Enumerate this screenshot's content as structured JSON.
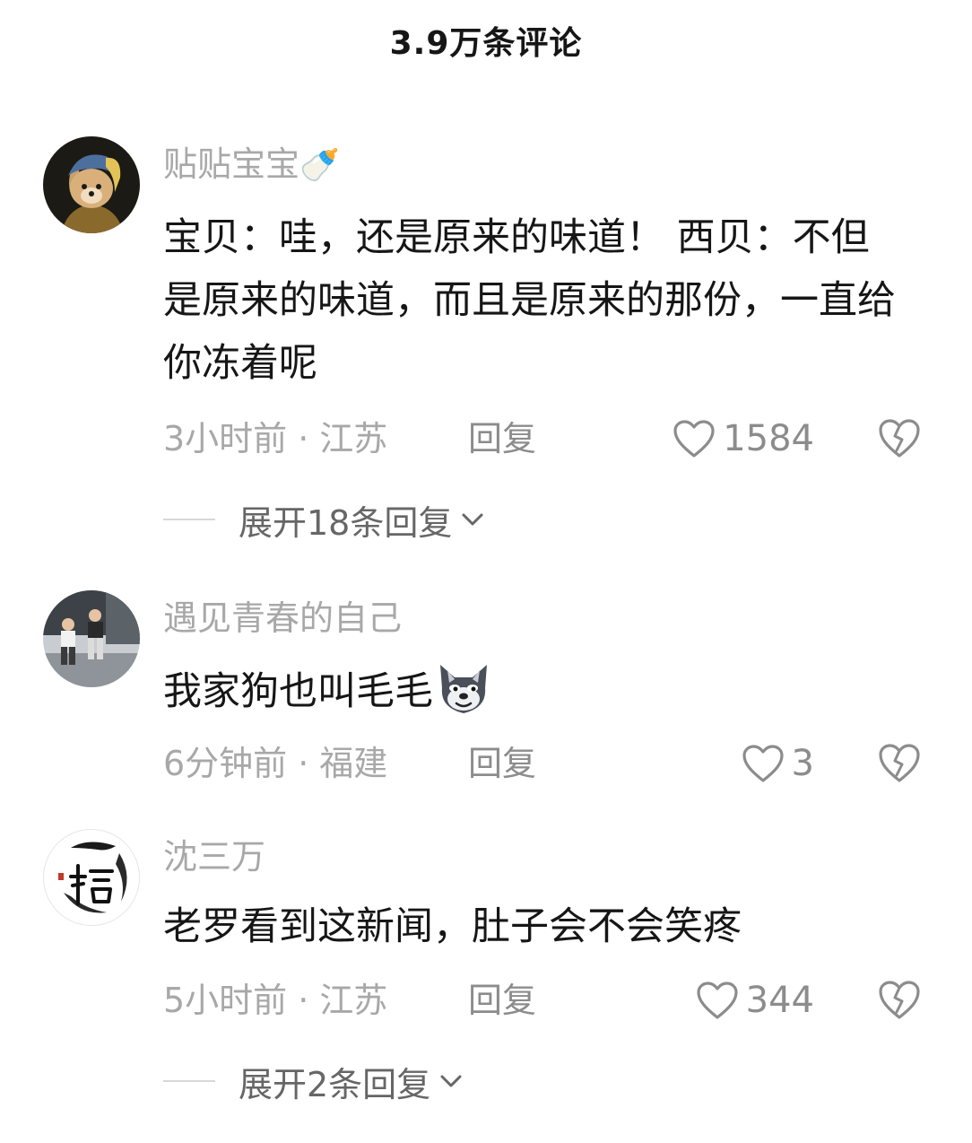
{
  "header": {
    "title": "3.9万条评论"
  },
  "comments": [
    {
      "username": "贴贴宝宝",
      "username_emoji": "🍼",
      "content": "宝贝：哇，还是原来的味道！ 西贝：不但是原来的味道，而且是原来的那份，一直给你冻着呢",
      "time": "3小时前",
      "location": "江苏",
      "reply_label": "回复",
      "likes": "1584",
      "expand_label": "展开18条回复"
    },
    {
      "username": "遇见青春的自己",
      "content": "我家狗也叫毛毛",
      "time": "6分钟前",
      "location": "福建",
      "reply_label": "回复",
      "likes": "3"
    },
    {
      "username": "沈三万",
      "content": "老罗看到这新闻，肚子会不会笑疼",
      "time": "5小时前",
      "location": "江苏",
      "reply_label": "回复",
      "likes": "344",
      "expand_label": "展开2条回复"
    }
  ],
  "separator": "·",
  "icons": {
    "like": "heart-outline-icon",
    "dislike": "broken-heart-icon",
    "expand": "chevron-down-icon",
    "content_emoji": "wolf-face-emoji"
  },
  "colors": {
    "text": "#161616",
    "muted": "#a8a8a8",
    "icon": "#8c8c8c"
  }
}
